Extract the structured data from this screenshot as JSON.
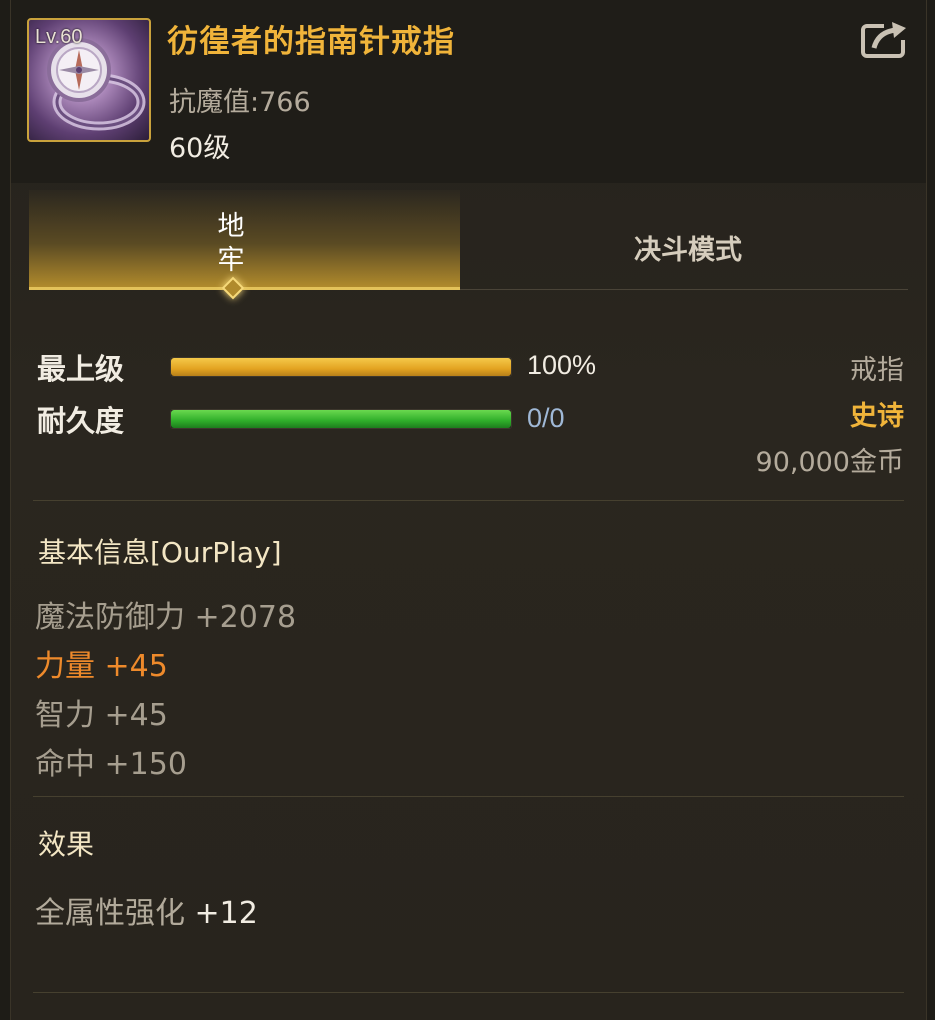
{
  "item": {
    "level_badge": "Lv.60",
    "name": "彷徨者的指南针戒指",
    "magic_resist": "抗魔值:766",
    "level_req": "60级"
  },
  "tabs": [
    {
      "label": "地牢",
      "active": true
    },
    {
      "label": "决斗模式",
      "active": false
    }
  ],
  "bars": {
    "grade": {
      "label": "最上级",
      "value_text": "100%",
      "fill": 1.0
    },
    "durability": {
      "label": "耐久度",
      "value_text": "0/0",
      "fill": 1.0
    }
  },
  "meta": {
    "type": "戒指",
    "rarity": "史诗",
    "price": "90,000金币"
  },
  "basic_info": {
    "title": "基本信息[OurPlay]",
    "attrs": [
      {
        "name": "魔法防御力",
        "value": "+2078",
        "highlight": false
      },
      {
        "name": "力量",
        "value": "+45",
        "highlight": true
      },
      {
        "name": "智力",
        "value": "+45",
        "highlight": false
      },
      {
        "name": "命中",
        "value": "+150",
        "highlight": false
      }
    ]
  },
  "effects": {
    "title": "效果",
    "lines": [
      {
        "name": "全属性强化",
        "value": "+12"
      }
    ]
  },
  "colors": {
    "name_gold": "#f0b43a",
    "rarity_epic": "#f0b43a",
    "highlight_orange": "#ee8a2b",
    "durability_value": "#9fb8d6"
  },
  "icons": {
    "item": "compass-ring-icon",
    "share": "share-export-icon"
  }
}
